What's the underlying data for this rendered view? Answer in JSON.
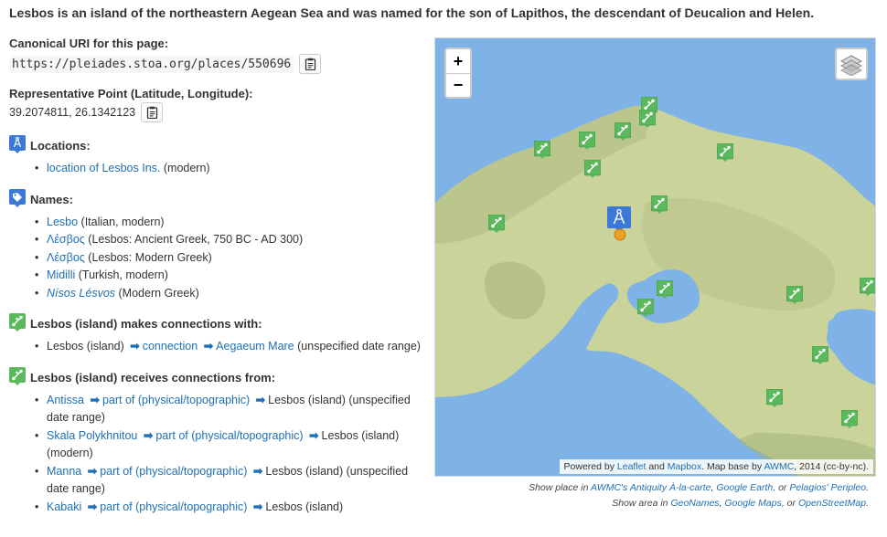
{
  "description": "Lesbos is an island of the northeastern Aegean Sea and was named for the son of Lapithos, the descendant of Deucalion and Helen.",
  "canonical": {
    "label": "Canonical URI for this page:",
    "uri": "https://pleiades.stoa.org/places/550696"
  },
  "repr_point": {
    "label": "Representative Point (Latitude, Longitude):",
    "value": "39.2074811, 26.1342123"
  },
  "locations": {
    "heading": "Locations:",
    "items": [
      {
        "link": "location of Lesbos Ins.",
        "rest": "(modern)"
      }
    ]
  },
  "names": {
    "heading": "Names:",
    "items": [
      {
        "link": "Lesbo",
        "rest": "(Italian, modern)"
      },
      {
        "link": "Λέσβος",
        "rest": "(Lesbos: Ancient Greek, 750 BC - AD 300)"
      },
      {
        "link": "Λέσβος",
        "rest": "(Lesbos: Modern Greek)"
      },
      {
        "link": "Midilli",
        "rest": "(Turkish, modern)"
      },
      {
        "link": "Nísos Lésvos",
        "rest": "(Modern Greek)"
      }
    ]
  },
  "makes": {
    "heading": "Lesbos (island) makes connections with:",
    "item": {
      "subject": "Lesbos (island)",
      "relation": "connection",
      "object": "Aegaeum Mare",
      "date": "(unspecified date range)"
    }
  },
  "receives": {
    "heading": "Lesbos (island) receives connections from:",
    "items": [
      {
        "subject": "Antissa",
        "relation": "part of (physical/topographic)",
        "object": "Lesbos (island)",
        "date": "(unspecified date range)"
      },
      {
        "subject": "Skala Polykhnitou",
        "relation": "part of (physical/topographic)",
        "object": "Lesbos (island)",
        "date": "(modern)"
      },
      {
        "subject": "Manna",
        "relation": "part of (physical/topographic)",
        "object": "Lesbos (island)",
        "date": "(unspecified date range)"
      },
      {
        "subject": "Kabaki",
        "relation": "part of (physical/topographic)",
        "object": "Lesbos (island)",
        "date": ""
      }
    ]
  },
  "map": {
    "zoom_in": "+",
    "zoom_out": "−",
    "attribution": {
      "prefix": "Powered by ",
      "leaflet": "Leaflet",
      "and": " and ",
      "mapbox": "Mapbox",
      "base": ". Map base by ",
      "awmc": "AWMC",
      "suffix": ", 2014 (cc-by-nc)."
    },
    "icons": {
      "zoom_in": "plus-icon",
      "zoom_out": "minus-icon",
      "layers": "layers-icon",
      "connection": "connection-icon",
      "location": "compass-icon",
      "name": "tag-icon"
    },
    "colors": {
      "sea": "#7fb2e6",
      "land": "#c9d39a",
      "marker_green": "#5cb85c",
      "marker_blue": "#3b78d8",
      "point_orange": "#f0a020"
    }
  },
  "show_place": {
    "prefix": "Show place in ",
    "awmc": "AWMC's Antiquity À-la-carte",
    "sep1": ", ",
    "gearth": "Google Earth",
    "sep2": ", or ",
    "pelagios": "Pelagios' Peripleo",
    "end": "."
  },
  "show_area": {
    "prefix": "Show area in ",
    "geonames": "GeoNames",
    "sep1": ", ",
    "gmaps": "Google Maps",
    "sep2": ", or ",
    "osm": "OpenStreetMap",
    "end": "."
  }
}
